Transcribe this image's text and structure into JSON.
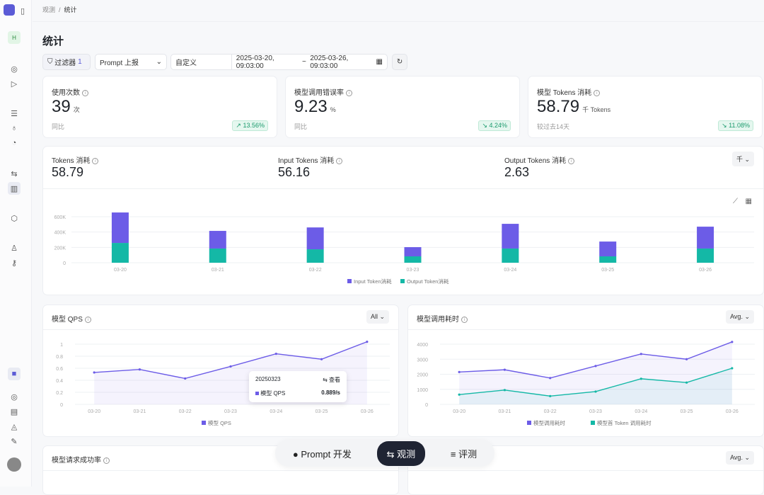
{
  "sidebar": {
    "avatar": "H",
    "icons": [
      "compass-icon",
      "play-icon",
      "database-icon",
      "bulb-icon",
      "gauge-icon",
      "trace-icon",
      "chart-icon",
      "cube-icon",
      "user-icon",
      "key-icon"
    ],
    "bottom_icons": [
      "app-logo-icon",
      "compass-icon",
      "doc-icon",
      "bell-icon",
      "plug-icon"
    ]
  },
  "breadcrumb": {
    "parent": "观测",
    "current": "统计"
  },
  "page_title": "统计",
  "toolbar": {
    "filter_label": "过滤器",
    "filter_count": "1",
    "report_select": "Prompt 上报",
    "range_select": "自定义",
    "start": "2025-03-20, 09:03:00",
    "sep": "~",
    "end": "2025-03-26, 09:03:00"
  },
  "kpis": [
    {
      "title": "使用次数",
      "value": "39",
      "unit": "次",
      "compare": "同比",
      "delta": "↗ 13.56%"
    },
    {
      "title": "模型调用错误率",
      "value": "9.23",
      "unit": "%",
      "compare": "同比",
      "delta": "↘ 4.24%"
    },
    {
      "title": "模型 Tokens 消耗",
      "value": "58.79",
      "unit": "千 Tokens",
      "compare": "较过去14天",
      "delta": "↘ 11.08%"
    }
  ],
  "tokens": {
    "items": [
      {
        "title": "Tokens 消耗",
        "value": "58.79"
      },
      {
        "title": "Input Tokens 消耗",
        "value": "56.16"
      },
      {
        "title": "Output Tokens 消耗",
        "value": "2.63"
      }
    ],
    "unit_select": "千"
  },
  "qps": {
    "title": "模型 QPS",
    "select": "All",
    "tooltip": {
      "date": "20250323",
      "action": "查看",
      "series": "模型 QPS",
      "value": "0.889/s"
    }
  },
  "latency": {
    "title": "模型调用耗时",
    "select": "Avg."
  },
  "success": {
    "title": "模型请求成功率"
  },
  "bottom_right": {
    "select": "Avg."
  },
  "dock": {
    "items": [
      "Prompt 开发",
      "观测",
      "评测"
    ],
    "active": 1
  },
  "colors": {
    "purple": "#6c5ce7",
    "teal": "#14b8a6",
    "accent": "#5b5bd6"
  },
  "chart_data": [
    {
      "type": "bar",
      "stacked": true,
      "categories": [
        "03-20",
        "03-21",
        "03-22",
        "03-23",
        "03-24",
        "03-25",
        "03-26"
      ],
      "series": [
        {
          "name": "Input Token消耗",
          "values": [
            397000,
            230000,
            285000,
            120000,
            322000,
            193000,
            285000
          ]
        },
        {
          "name": "Output Token消耗",
          "values": [
            258000,
            185000,
            175000,
            83000,
            185000,
            83000,
            185000
          ]
        }
      ],
      "yticks": [
        "0",
        "200K",
        "400K",
        "600K"
      ],
      "ylim": [
        0,
        600000
      ],
      "legend": "bottom"
    },
    {
      "type": "line",
      "categories": [
        "03-20",
        "03-21",
        "03-22",
        "03-23",
        "03-24",
        "03-25",
        "03-26"
      ],
      "series": [
        {
          "name": "模型 QPS",
          "values": [
            0.53,
            0.58,
            0.43,
            0.63,
            0.84,
            0.75,
            1.04
          ]
        }
      ],
      "yticks": [
        "0",
        "0.2",
        "0.4",
        "0.6",
        "0.8",
        "1"
      ],
      "ylim": [
        0,
        1
      ],
      "legend": "bottom"
    },
    {
      "type": "line",
      "categories": [
        "03-20",
        "03-21",
        "03-22",
        "03-23",
        "03-24",
        "03-25",
        "03-26"
      ],
      "series": [
        {
          "name": "模型调用耗时",
          "values": [
            2150,
            2300,
            1750,
            2550,
            3350,
            3000,
            4150
          ]
        },
        {
          "name": "模型首 Token 调用耗时",
          "values": [
            650,
            950,
            550,
            850,
            1700,
            1450,
            2400
          ]
        }
      ],
      "yticks": [
        "0",
        "1000",
        "2000",
        "3000",
        "4000"
      ],
      "ylim": [
        0,
        4000
      ],
      "legend": "bottom"
    }
  ]
}
